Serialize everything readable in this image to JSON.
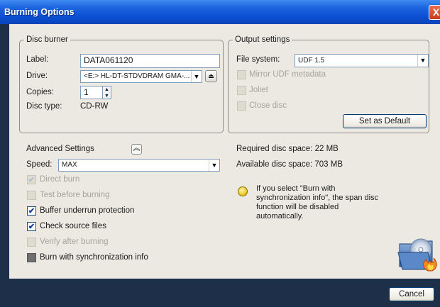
{
  "window": {
    "title": "Burning Options",
    "close_label": "X"
  },
  "disc_burner": {
    "legend": "Disc burner",
    "label_caption": "Label:",
    "label_value": "DATA061120",
    "drive_caption": "Drive:",
    "drive_value": "<E:> HL-DT-STDVDRAM GMA-...",
    "copies_caption": "Copies:",
    "copies_value": "1",
    "disc_type_caption": "Disc type:",
    "disc_type_value": "CD-RW"
  },
  "output_settings": {
    "legend": "Output settings",
    "file_system_caption": "File system:",
    "file_system_value": "UDF 1.5",
    "mirror_udf": "Mirror UDF metadata",
    "joliet": "Joliet",
    "close_disc": "Close disc",
    "set_default": "Set as Default"
  },
  "advanced": {
    "title": "Advanced Settings",
    "speed_caption": "Speed:",
    "speed_value": "MAX",
    "direct_burn": "Direct burn",
    "test_before": "Test before burning",
    "buffer_underrun": "Buffer underrun protection",
    "check_source": "Check source files",
    "verify_after": "Verify after burning",
    "burn_sync": "Burn with synchronization info"
  },
  "info": {
    "required_space": "Required disc space: 22 MB",
    "available_space": "Available disc space: 703 MB",
    "tip": "If you select \"Burn with synchronization info\", the span disc function will be disabled automatically."
  },
  "footer": {
    "cancel": "Cancel"
  }
}
